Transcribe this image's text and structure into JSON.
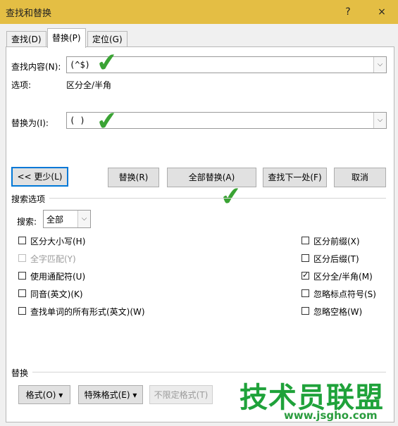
{
  "window": {
    "title": "查找和替换",
    "help": "?",
    "close": "×"
  },
  "tabs": [
    {
      "label": "查找(D)"
    },
    {
      "label": "替换(P)"
    },
    {
      "label": "定位(G)"
    }
  ],
  "find": {
    "label": "查找内容(N):",
    "value": "(^$)",
    "options_label": "选项:",
    "options_value": "区分全/半角"
  },
  "replace": {
    "label": "替换为(I):",
    "value": "( )"
  },
  "buttons": {
    "less": "<< 更少(L)",
    "replace": "替换(R)",
    "replace_all": "全部替换(A)",
    "find_next": "查找下一处(F)",
    "cancel": "取消"
  },
  "search_options": {
    "header": "搜索选项",
    "search_label": "搜索:",
    "search_value": "全部"
  },
  "left_options": [
    {
      "label": "区分大小写(H)",
      "checked": false,
      "disabled": false
    },
    {
      "label": "全字匹配(Y)",
      "checked": false,
      "disabled": true
    },
    {
      "label": "使用通配符(U)",
      "checked": false,
      "disabled": false
    },
    {
      "label": "同音(英文)(K)",
      "checked": false,
      "disabled": false
    },
    {
      "label": "查找单词的所有形式(英文)(W)",
      "checked": false,
      "disabled": false
    }
  ],
  "right_options": [
    {
      "label": "区分前缀(X)",
      "checked": false
    },
    {
      "label": "区分后缀(T)",
      "checked": false
    },
    {
      "label": "区分全/半角(M)",
      "checked": true
    },
    {
      "label": "忽略标点符号(S)",
      "checked": false
    },
    {
      "label": "忽略空格(W)",
      "checked": false
    }
  ],
  "replace_section": {
    "header": "替换",
    "format": "格式(O)",
    "special": "特殊格式(E)",
    "no_format": "不限定格式(T)"
  },
  "watermark": {
    "big": "技术员联盟",
    "small": "www.jsgho.com"
  },
  "colors": {
    "titlebar": "#e4be44",
    "focus": "#0078d7",
    "check": "#3aa334"
  }
}
